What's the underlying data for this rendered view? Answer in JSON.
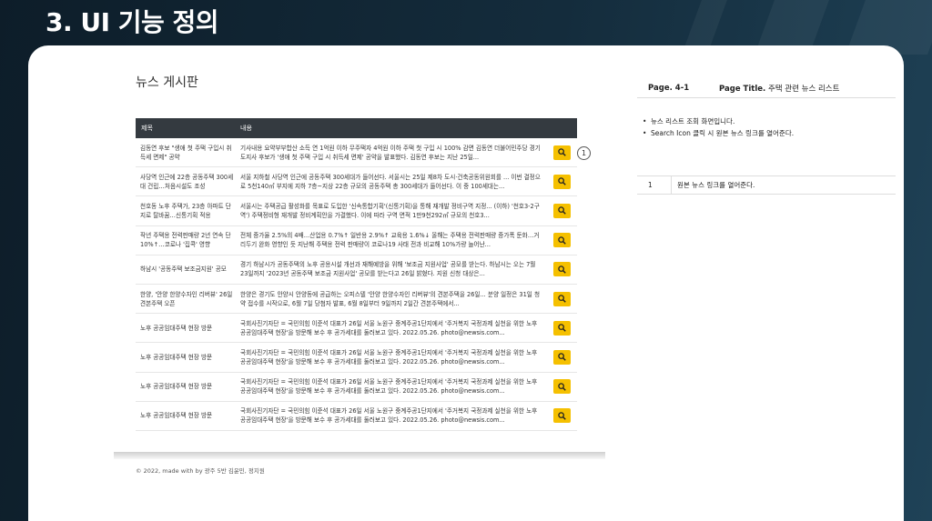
{
  "slide": {
    "title": "3. UI 기능 정의"
  },
  "mockup": {
    "board_title": "뉴스 게시판",
    "table_header": {
      "title": "제목",
      "content": "내용"
    },
    "rows": [
      {
        "title": "김동연 후보 \"생애 첫 주택 구입시 취득세 면제\" 공약",
        "content": "기사내용 요약부부합산 소득 연 1억원 이하 무주택자 4억원 이하 주택 첫 구입 시 100% 감면 김동연 더불어민주당 경기도지사 후보가 '생애 첫 주택 구입 시 취득세 면제' 공약을 발표했다. 김동연 후보는 지난 25일..."
      },
      {
        "title": "사당역 인근에 22층 공동주택 300세대 건립…처음시설도 조성",
        "content": "서울 지하철 사당역 인근에 공동주택 300세대가 들어선다. 서울시는 25일 제8차 도시·건축공동위원회를 ... 이번 결정으로 5천140㎡ 부지에 지하 7층~지상 22층 규모의 공동주택 총 300세대가 들어선다. 이 중 100세대는..."
      },
      {
        "title": "천호동 노후 주택가, 23층 아파트 단지로 탈바꿈…신통기획 적용",
        "content": "서울시는 주택공급 활성화를 목표로 도입한 '신속통합기획'(신통기획)을 통해 재개발 정비구역 지정... (이하) '천호3-2구역') 주택정비형 재개발 정비계획안을 가결했다. 이에 따라 구역 면적 1만9천292㎡ 규모의 천호3..."
      },
      {
        "title": "작년 주택용 전력판매량 2년 연속 단 10%↑…코로나 '집콕' 영향",
        "content": "전체 증가율 2.5%의 4배…산업용 0.7%↑ 일반용 2.9%↑ 교육용 1.6%↓ 올해는 주택용 전력판매량 증가폭 둔화…거리두기 완화 영향인 듯 지난해 주택용 전력 판매량이 코로나19 사태 전과 비교해 10%가량 늘어난..."
      },
      {
        "title": "하남시 '공동주택 보조금지원' 공모",
        "content": "경기 하남시가 공동주택의 노후 공용시설 개선과 재해예방을 위해 '보조금 지원사업' 공모를 받는다. 하남시는 오는 7월23일까지 '2023년 공동주택 보조금 지원사업' 공모를 받는다고 26일 밝혔다. 지원 신청 대상은..."
      },
      {
        "title": "한양, '안양 한양수자인 리버뷰' 26일 견본주택 오픈",
        "content": "한양은 경기도 안양시 안양동에 공급하는 오피스텔 '안양 한양수자인 리버뷰'의 견본주택을 26일... 분양 일정은 31일 청약 접수를 시작으로, 6월 7일 당첨자 발표, 6월 8일부터 9일까지 2일간 견본주택에서..."
      },
      {
        "title": "노후 공공임대주택 현장 방문",
        "content": "국회사진기자단 = 국민의힘 이준석 대표가 26일 서울 노원구 중계주공1단지에서 '주거복지 국정과제 실천을 위한 노후 공공임대주택 현장'을 방문해 보수 후 공가세대를 둘러보고 있다. 2022.05.26. photo@newsis.com..."
      },
      {
        "title": "노후 공공임대주택 현장 방문",
        "content": "국회사진기자단 = 국민의힘 이준석 대표가 26일 서울 노원구 중계주공1단지에서 '주거복지 국정과제 실천을 위한 노후 공공임대주택 현장'을 방문해 보수 후 공가세대를 둘러보고 있다. 2022.05.26. photo@newsis.com..."
      },
      {
        "title": "노후 공공임대주택 현장 방문",
        "content": "국회사진기자단 = 국민의힘 이준석 대표가 26일 서울 노원구 중계주공1단지에서 '주거복지 국정과제 실천을 위한 노후 공공임대주택 현장'을 방문해 보수 후 공가세대를 둘러보고 있다. 2022.05.26. photo@newsis.com..."
      },
      {
        "title": "노후 공공임대주택 현장 방문",
        "content": "국회사진기자단 = 국민의힘 이준석 대표가 26일 서울 노원구 중계주공1단지에서 '주거복지 국정과제 실천을 위한 노후 공공임대주택 현장'을 방문해 보수 후 공가세대를 둘러보고 있다. 2022.05.26. photo@newsis.com..."
      }
    ],
    "callout_number": "1",
    "footer": "© 2022, made with by 광주 5반 김윤민, 정지원"
  },
  "spec": {
    "page_label": "Page. 4-1",
    "page_title_label": "Page Title.",
    "page_title_value": "주택 관련 뉴스 리스트",
    "description": [
      "뉴스 리스트 조회 화면입니다.",
      "Search Icon 클릭 시 원본 뉴스 링크를 열어준다."
    ],
    "items": [
      {
        "num": "1",
        "text": "원본 뉴스 링크를 열어준다."
      }
    ]
  },
  "colors": {
    "accent": "#f5c000",
    "header_bg": "#343a40"
  },
  "icons": {
    "row_action": "search-icon"
  }
}
